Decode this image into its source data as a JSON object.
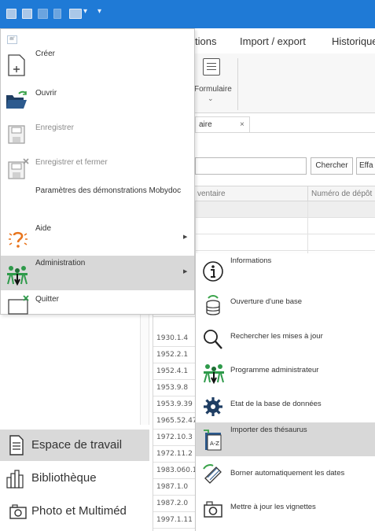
{
  "ribbon": {
    "tabs": [
      {
        "label": "tions"
      },
      {
        "label": "Import / export"
      },
      {
        "label": "Historique"
      }
    ],
    "formulaire_label": "Formulaire"
  },
  "document_tab": {
    "label": "aire",
    "close": "×"
  },
  "search": {
    "button_label": "Chercher",
    "clear_label": "Effa"
  },
  "grid": {
    "columns": [
      "ventaire",
      "Numéro de dépôt"
    ],
    "rows": [
      "",
      "",
      "",
      "",
      "",
      "",
      "",
      "1930.1.4",
      "1952.2.1",
      "1952.4.1",
      "1953.9.8",
      "1953.9.39",
      "1965.52.47",
      "1972.10.3",
      "1972.11.2",
      "1983.060.1",
      "1987.1.0",
      "1987.2.0",
      "1997.1.11"
    ]
  },
  "nav": {
    "items": [
      {
        "label": "Espace de travail",
        "icon": "document-icon",
        "selected": true
      },
      {
        "label": "Bibliothèque",
        "icon": "books-icon",
        "selected": false
      },
      {
        "label": "Photo et Multiméd",
        "icon": "camera-icon",
        "selected": false
      }
    ]
  },
  "app_menu": {
    "badge": "m'",
    "items": [
      {
        "label": "Créer",
        "icon": "new-file-icon"
      },
      {
        "label": "Ouvrir",
        "icon": "open-folder-icon"
      },
      {
        "label": "Enregistrer",
        "icon": "save-icon"
      },
      {
        "label": "Enregistrer et fermer",
        "icon": "save-close-icon"
      },
      {
        "label": "Paramètres des démonstrations Mobydoc"
      },
      {
        "label": "Aide",
        "icon": "help-icon"
      },
      {
        "label": "Administration",
        "icon": "admin-people-icon"
      },
      {
        "label": "Quitter",
        "icon": "quit-icon"
      }
    ]
  },
  "admin_submenu": {
    "items": [
      {
        "label": "Informations",
        "icon": "info-icon"
      },
      {
        "label": "Ouverture d'une base",
        "icon": "open-database-icon"
      },
      {
        "label": "Rechercher les mises à jour",
        "icon": "search-updates-icon"
      },
      {
        "label": "Programme administrateur",
        "icon": "admin-program-icon"
      },
      {
        "label": "Etat de la base de données",
        "icon": "database-status-gear-icon"
      },
      {
        "label": "Importer des thésaurus",
        "icon": "import-thesaurus-icon"
      },
      {
        "label": "Borner automatiquement les dates",
        "icon": "date-bounds-icon"
      },
      {
        "label": "Mettre à jour les vignettes",
        "icon": "thumbnails-camera-icon"
      }
    ]
  },
  "colors": {
    "titlebar": "#1f7ad6",
    "hover": "#d8d8d8",
    "accent_green": "#2e9a4a",
    "accent_orange": "#e98a1c"
  }
}
